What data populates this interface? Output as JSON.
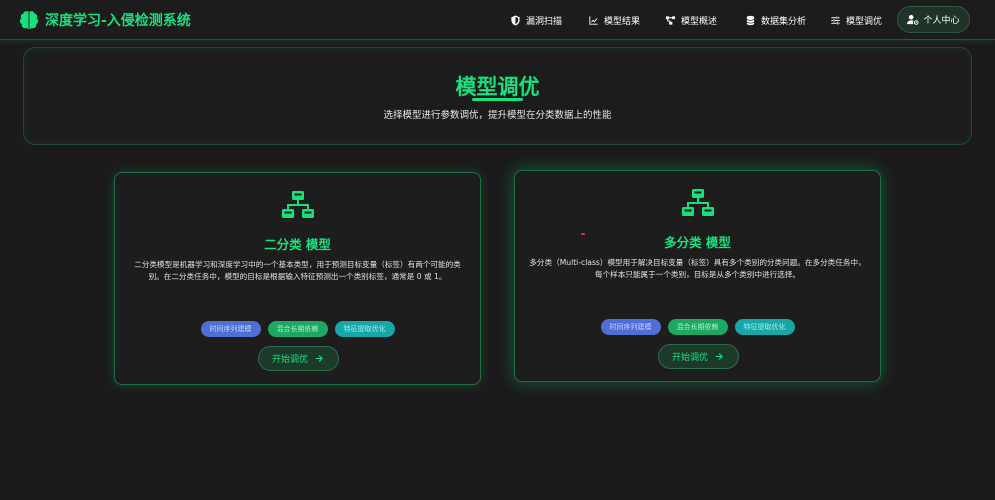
{
  "nav": {
    "brand": "深度学习-入侵检测系统",
    "items": [
      {
        "label": "漏洞扫描",
        "icon": "shield-icon"
      },
      {
        "label": "模型结果",
        "icon": "chart-line-icon"
      },
      {
        "label": "模型概述",
        "icon": "project-diagram-icon"
      },
      {
        "label": "数据集分析",
        "icon": "database-icon"
      },
      {
        "label": "模型调优",
        "icon": "sliders-icon"
      }
    ],
    "user": {
      "label": "个人中心",
      "icon": "user-gear-icon"
    }
  },
  "hero": {
    "title": "模型调优",
    "subtitle": "选择模型进行参数调优，提升模型在分类数据上的性能"
  },
  "cards": [
    {
      "title": "二分类 模型",
      "description": "二分类模型是机器学习和深度学习中的一个基本类型，用于预测目标变量（标签）有两个可能的类别。在二分类任务中，模型的目标是根据输入特征预测出一个类别标签，通常是 0 或 1。",
      "tags": [
        "时间序列建模",
        "混合长期依赖",
        "特征提取优化"
      ],
      "button": "开始调优"
    },
    {
      "title": "多分类 模型",
      "description": "多分类（Multi-class）模型用于解决目标变量（标签）具有多个类别的分类问题。在多分类任务中，每个样本只能属于一个类别，目标是从多个类别中进行选择。",
      "tags": [
        "时间序列建模",
        "混合长期依赖",
        "特征提取优化"
      ],
      "button": "开始调优"
    }
  ],
  "colors": {
    "accent": "#18e07d",
    "background": "#1b1b1b",
    "tag_blue": "#4f6fd6",
    "tag_green": "#1ea763",
    "tag_teal": "#19a6a6"
  }
}
